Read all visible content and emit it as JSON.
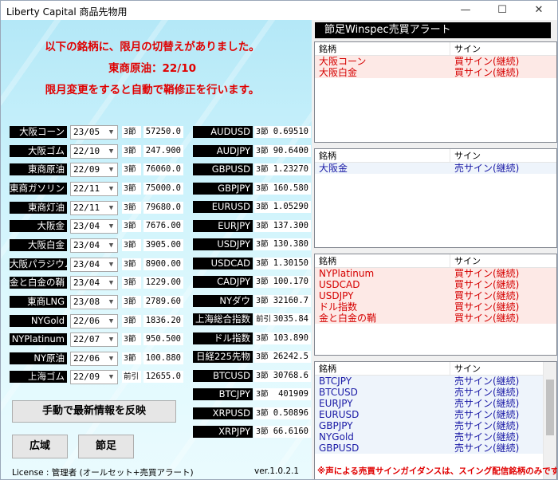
{
  "window": {
    "title": "Liberty Capital 商品先物用",
    "minimize": "—",
    "maximize": "☐",
    "close": "✕"
  },
  "notice": {
    "line1": "以下の銘柄に、限月の切替えがありました。",
    "line2": "東商原油：22/10",
    "line3": "限月変更をすると自動で鞘修正を行います。"
  },
  "commodities": [
    {
      "name": "大阪コーン",
      "month": "23/05",
      "setting": "3節",
      "value": "57250.0"
    },
    {
      "name": "大阪ゴム",
      "month": "22/10",
      "setting": "3節",
      "value": "247.900"
    },
    {
      "name": "東商原油",
      "month": "22/09",
      "setting": "3節",
      "value": "76060.0"
    },
    {
      "name": "東商ガソリン",
      "month": "22/11",
      "setting": "3節",
      "value": "75000.0"
    },
    {
      "name": "東商灯油",
      "month": "22/11",
      "setting": "3節",
      "value": "79680.0"
    },
    {
      "name": "大阪金",
      "month": "23/04",
      "setting": "3節",
      "value": "7676.00"
    },
    {
      "name": "大阪白金",
      "month": "23/04",
      "setting": "3節",
      "value": "3905.00"
    },
    {
      "name": "大阪パラジウム",
      "month": "23/04",
      "setting": "3節",
      "value": "8900.00"
    },
    {
      "name": "金と白金の鞘",
      "month": "23/04",
      "setting": "3節",
      "value": "1229.00"
    },
    {
      "name": "東商LNG",
      "month": "23/08",
      "setting": "3節",
      "value": "2789.60"
    },
    {
      "name": "NYGold",
      "month": "22/06",
      "setting": "3節",
      "value": "1836.20"
    },
    {
      "name": "NYPlatinum",
      "month": "22/07",
      "setting": "3節",
      "value": "950.500"
    },
    {
      "name": "NY原油",
      "month": "22/06",
      "setting": "3節",
      "value": "100.880"
    },
    {
      "name": "上海ゴム",
      "month": "22/09",
      "setting": "前引",
      "value": "12655.0"
    }
  ],
  "instruments": [
    {
      "name": "AUDUSD",
      "setting": "3節",
      "value": "0.69510"
    },
    {
      "name": "AUDJPY",
      "setting": "3節",
      "value": "90.6400"
    },
    {
      "name": "GBPUSD",
      "setting": "3節",
      "value": "1.23270"
    },
    {
      "name": "GBPJPY",
      "setting": "3節",
      "value": "160.580"
    },
    {
      "name": "EURUSD",
      "setting": "3節",
      "value": "1.05290"
    },
    {
      "name": "EURJPY",
      "setting": "3節",
      "value": "137.300"
    },
    {
      "name": "USDJPY",
      "setting": "3節",
      "value": "130.380"
    },
    {
      "name": "USDCAD",
      "setting": "3節",
      "value": "1.30150"
    },
    {
      "name": "CADJPY",
      "setting": "3節",
      "value": "100.170"
    },
    {
      "name": "NYダウ",
      "setting": "3節",
      "value": "32160.7"
    },
    {
      "name": "上海総合指数",
      "setting": "前引",
      "value": "3035.84"
    },
    {
      "name": "ドル指数",
      "setting": "3節",
      "value": "103.890"
    },
    {
      "name": "日経225先物",
      "setting": "3節",
      "value": "26242.5"
    },
    {
      "name": "BTCUSD",
      "setting": "3節",
      "value": "30768.6"
    },
    {
      "name": "BTCJPY",
      "setting": "3節",
      "value": "401909"
    },
    {
      "name": "XRPUSD",
      "setting": "3節",
      "value": "0.50896"
    },
    {
      "name": "XRPJPY",
      "setting": "3節",
      "value": "66.6160"
    }
  ],
  "buttons": {
    "refresh": "手動で最新情報を反映",
    "wide": "広域",
    "setsu": "節足"
  },
  "footer": {
    "license": "License : 管理者 (オールセット+売買アラート)",
    "version": "ver.1.0.2.1",
    "warning": "※声による売買サインガイダンスは、スイング配信銘柄のみです"
  },
  "alert": {
    "header": "節足Winspec売買アラート",
    "col_name": "銘柄",
    "col_sign": "サイン",
    "panels": [
      {
        "rows": [
          {
            "name": "大阪コーン",
            "sign": "買サイン(継続)"
          },
          {
            "name": "大阪白金",
            "sign": "買サイン(継続)"
          }
        ]
      },
      {
        "rows": [
          {
            "name": "大阪金",
            "sign": "売サイン(継続)"
          }
        ]
      },
      {
        "rows": [
          {
            "name": "NYPlatinum",
            "sign": "買サイン(継続)"
          },
          {
            "name": "USDCAD",
            "sign": "買サイン(継続)"
          },
          {
            "name": "USDJPY",
            "sign": "買サイン(継続)"
          },
          {
            "name": "ドル指数",
            "sign": "買サイン(継続)"
          },
          {
            "name": "金と白金の鞘",
            "sign": "買サイン(継続)"
          }
        ]
      },
      {
        "rows": [
          {
            "name": "BTCJPY",
            "sign": "売サイン(継続)"
          },
          {
            "name": "BTCUSD",
            "sign": "売サイン(継続)"
          },
          {
            "name": "EURJPY",
            "sign": "売サイン(継続)"
          },
          {
            "name": "EURUSD",
            "sign": "売サイン(継続)"
          },
          {
            "name": "GBPJPY",
            "sign": "売サイン(継続)"
          },
          {
            "name": "NYGold",
            "sign": "売サイン(継続)"
          },
          {
            "name": "GBPUSD",
            "sign": "売サイン(継続)"
          }
        ]
      }
    ]
  },
  "colors": {
    "alert_red": "#d50000",
    "alert_blue": "#1a1aa6",
    "notice_red": "#e00000",
    "label_bg": "#000000"
  }
}
